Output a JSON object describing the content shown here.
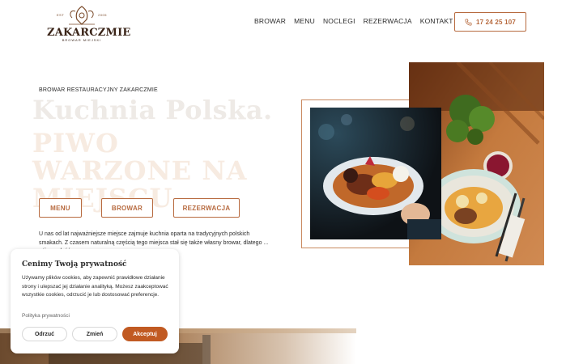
{
  "header": {
    "logo": {
      "est": "EST",
      "year": "2005",
      "name": "ZAKARCZMIE",
      "subtitle": "BROWAR MIEJSKI"
    },
    "nav": [
      {
        "label": "BROWAR"
      },
      {
        "label": "MENU"
      },
      {
        "label": "NOCLEGI"
      },
      {
        "label": "REZERWACJA"
      },
      {
        "label": "KONTAKT"
      }
    ],
    "phone": {
      "icon": "phone-icon",
      "number": "17 24 25 107"
    }
  },
  "hero": {
    "kicker": "BROWAR RESTAURACYJNY ZAKARCZMIE",
    "title": "Kuchnia Polska.",
    "subtitle": "PIWO WARZONE NA MIEJSCU.",
    "buttons": [
      {
        "label": "MENU"
      },
      {
        "label": "BROWAR"
      },
      {
        "label": "REZERWACJA"
      }
    ],
    "lead": "U nas od lat najważniejsze miejsce zajmuje kuchnia oparta na tradycyjnych polskich smakach. Z czasem naturalną częścią tego miejsca stał się także własny browar, dlatego ... pójną całość."
  },
  "cookie": {
    "title": "Cenimy Twoją prywatność",
    "text": "Używamy plików cookies, aby zapewnić prawidłowe działanie strony i ulepszać jej działanie analityką. Możesz zaakceptować wszystkie cookies, odrzucić je lub dostosować preferencje.",
    "policy": "Polityka prywatności",
    "reject": "Odrzuć",
    "change": "Zmień",
    "accept": "Akceptuj"
  },
  "colors": {
    "accent": "#b76a3f",
    "accept": "#c15a22",
    "title_faded": "#eeeae6",
    "subtitle_faded": "#f7ebe1"
  }
}
